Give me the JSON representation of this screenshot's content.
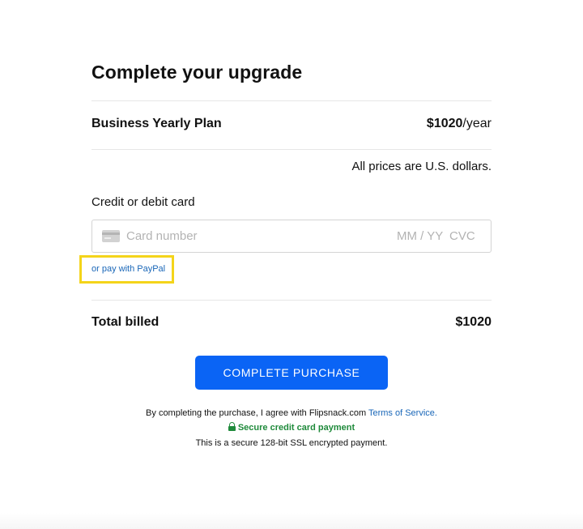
{
  "header": {
    "title": "Complete your upgrade"
  },
  "plan": {
    "name": "Business Yearly Plan",
    "price": "$1020",
    "period": "/year"
  },
  "currency_note": "All prices are U.S. dollars.",
  "card": {
    "label": "Credit or debit card",
    "number_placeholder": "Card number",
    "expiry_placeholder": "MM / YY",
    "cvc_placeholder": "CVC",
    "icon": "credit-card-icon"
  },
  "paypal": {
    "link_text": "or pay with PayPal",
    "highlight_color": "#f4d41a"
  },
  "total": {
    "label": "Total billed",
    "value": "$1020"
  },
  "purchase_button": {
    "label": "COMPLETE PURCHASE",
    "color": "#0a64f5"
  },
  "footer": {
    "terms_prefix": "By completing the purchase, I agree with Flipsnack.com ",
    "terms_link": "Terms of Service.",
    "secure_label": "Secure credit card payment",
    "secure_icon": "lock-icon",
    "secure_color": "#1f8a3b",
    "ssl_note": "This is a secure 128-bit SSL encrypted payment."
  }
}
